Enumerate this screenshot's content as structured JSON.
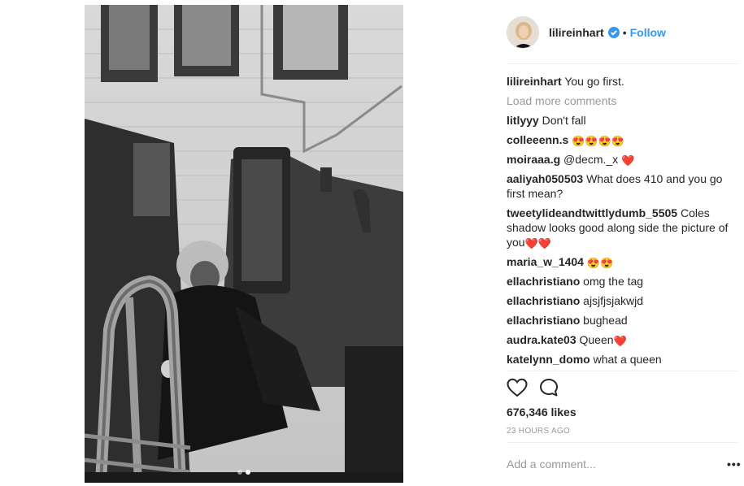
{
  "post": {
    "carousel": {
      "total": 2,
      "active": 2
    }
  },
  "header": {
    "username": "lilireinhart",
    "separator": "•",
    "follow_label": "Follow"
  },
  "caption": {
    "user": "lilireinhart",
    "text": "You go first."
  },
  "load_more_label": "Load more comments",
  "comments": [
    {
      "user": "litlyyy",
      "text": "Don't fall",
      "emoji": ""
    },
    {
      "user": "colleeenn.s",
      "text": "",
      "emoji": "😍😍😍😍"
    },
    {
      "user": "moiraaa.g",
      "text": "@decm._x",
      "emoji": "❤️"
    },
    {
      "user": "aaliyah050503",
      "text": "What does 410 and you go first mean?",
      "emoji": ""
    },
    {
      "user": "tweetylideandtwittlydumb_5505",
      "text": "Coles shadow looks good along side the picture of you",
      "emoji": "❤️❤️"
    },
    {
      "user": "maria_w_1404",
      "text": "",
      "emoji": "😍😍"
    },
    {
      "user": "ellachristiano",
      "text": "omg the tag",
      "emoji": ""
    },
    {
      "user": "ellachristiano",
      "text": "ajsjfjsjakwjd",
      "emoji": ""
    },
    {
      "user": "ellachristiano",
      "text": "bughead",
      "emoji": ""
    },
    {
      "user": "audra.kate03",
      "text": "Queen",
      "emoji": "❤️"
    },
    {
      "user": "katelynn_domo",
      "text": "what a queen",
      "emoji": ""
    }
  ],
  "likes_label": "676,346 likes",
  "timestamp": "23 HOURS AGO",
  "add_comment_placeholder": "Add a comment...",
  "more_label": "•••",
  "colors": {
    "link": "#3897f0",
    "muted": "#999999",
    "text": "#262626",
    "heart": "#ed4956"
  },
  "icons": {
    "like": "heart-icon",
    "comment": "comment-bubble-icon",
    "verified": "verified-badge-icon",
    "more": "more-options-icon"
  }
}
